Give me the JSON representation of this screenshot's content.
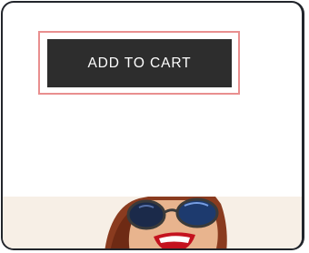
{
  "product": {
    "add_to_cart_label": "ADD TO CART"
  },
  "colors": {
    "button_bg": "#2d2d2d",
    "button_text": "#ffffff",
    "focus_outline": "#e98f8f",
    "frame_border": "#22252b",
    "banner_bg": "#f7efe6"
  },
  "icons": {
    "banner_image": "woman-with-sunglasses-photo"
  }
}
